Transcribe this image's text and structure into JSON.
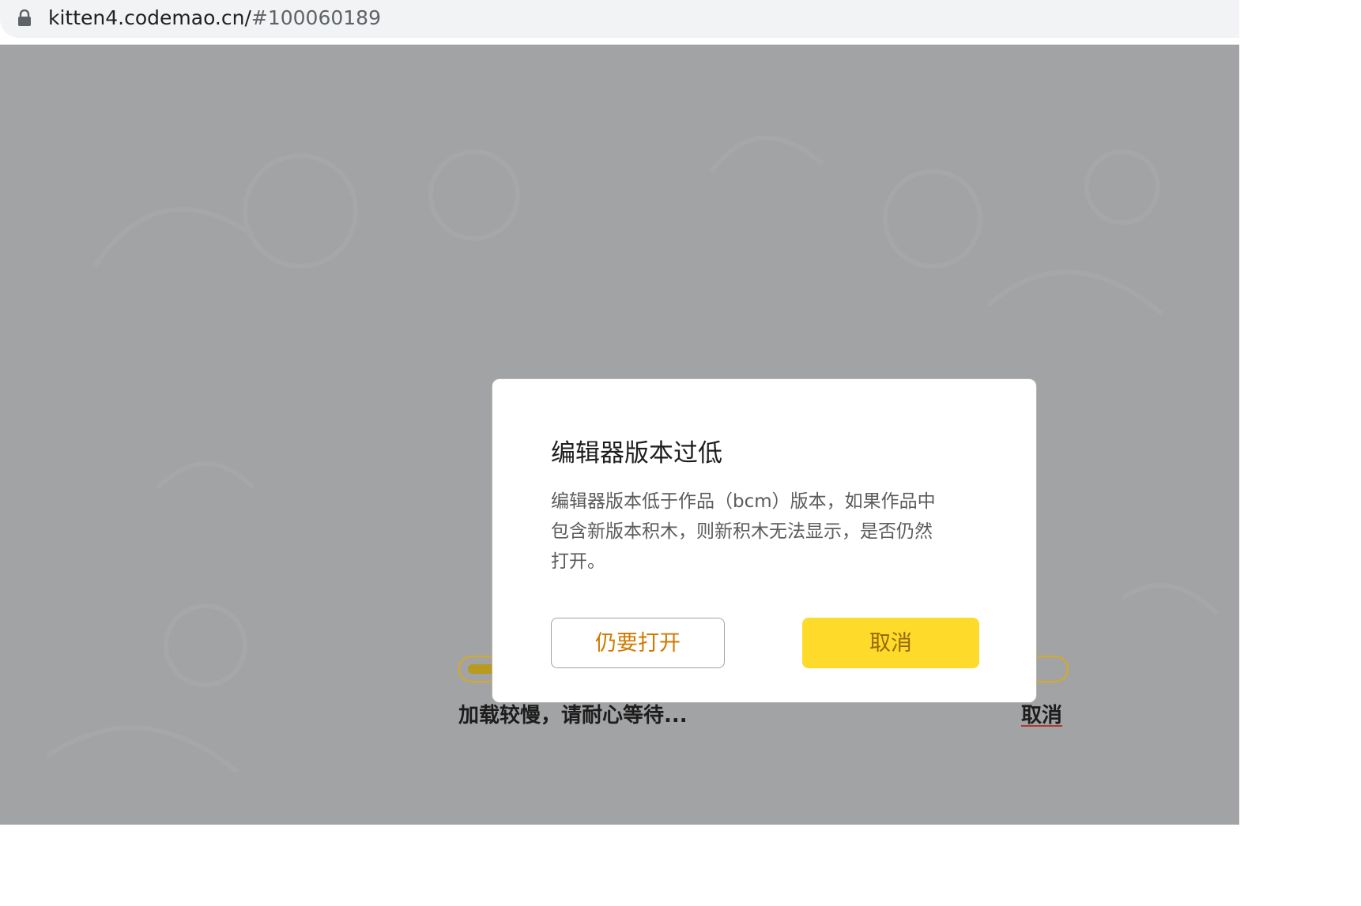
{
  "browser": {
    "url_host": "kitten4.codemao.cn/",
    "url_hash": "#100060189"
  },
  "loading": {
    "message": "加载较慢，请耐心等待...",
    "cancel_label": "取消",
    "progress": 0.05
  },
  "dialog": {
    "title": "编辑器版本过低",
    "body_lines": [
      "编辑器版本低于作品（bcm）版本，如果作品中",
      "包含新版本积木，则新积木无法显示，是否仍然",
      "打开。"
    ],
    "open_anyway_label": "仍要打开",
    "cancel_label": "取消"
  },
  "colors": {
    "overlay": "#a2a3a5",
    "accent_yellow": "#fedb2a",
    "open_text": "#cf7a00",
    "cancel_text": "#9a6800",
    "progress_border": "#d8aa1e"
  }
}
